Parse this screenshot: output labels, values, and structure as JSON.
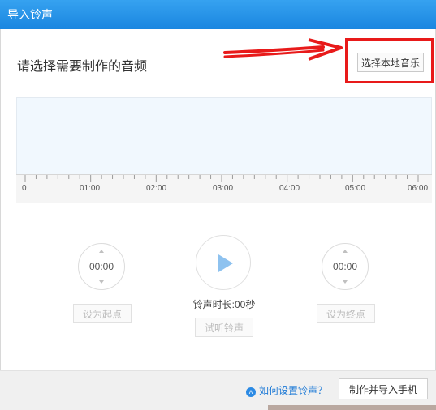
{
  "window": {
    "title": "导入铃声"
  },
  "prompt": "请选择需要制作的音频",
  "pick_button": "选择本地音乐",
  "timeline": {
    "labels": [
      "0",
      "01:00",
      "02:00",
      "03:00",
      "04:00",
      "05:00",
      "06:00"
    ]
  },
  "start_dial": {
    "value": "00:00"
  },
  "end_dial": {
    "value": "00:00"
  },
  "set_start": "设为起点",
  "set_end": "设为终点",
  "duration_text": "铃声时长:00秒",
  "preview_button": "试听铃声",
  "footer": {
    "help_link": "如何设置铃声？",
    "import_button": "制作并导入手机"
  },
  "colors": {
    "title_bar": "#1a86e0",
    "annotation": "#e81a1a",
    "waveform_bg": "#f1f8fe",
    "play_triangle": "#8ec2ef"
  },
  "icons": [
    "play-icon",
    "chevron-up-icon",
    "chevron-down-icon",
    "help-icon",
    "red-arrow-annotation"
  ]
}
